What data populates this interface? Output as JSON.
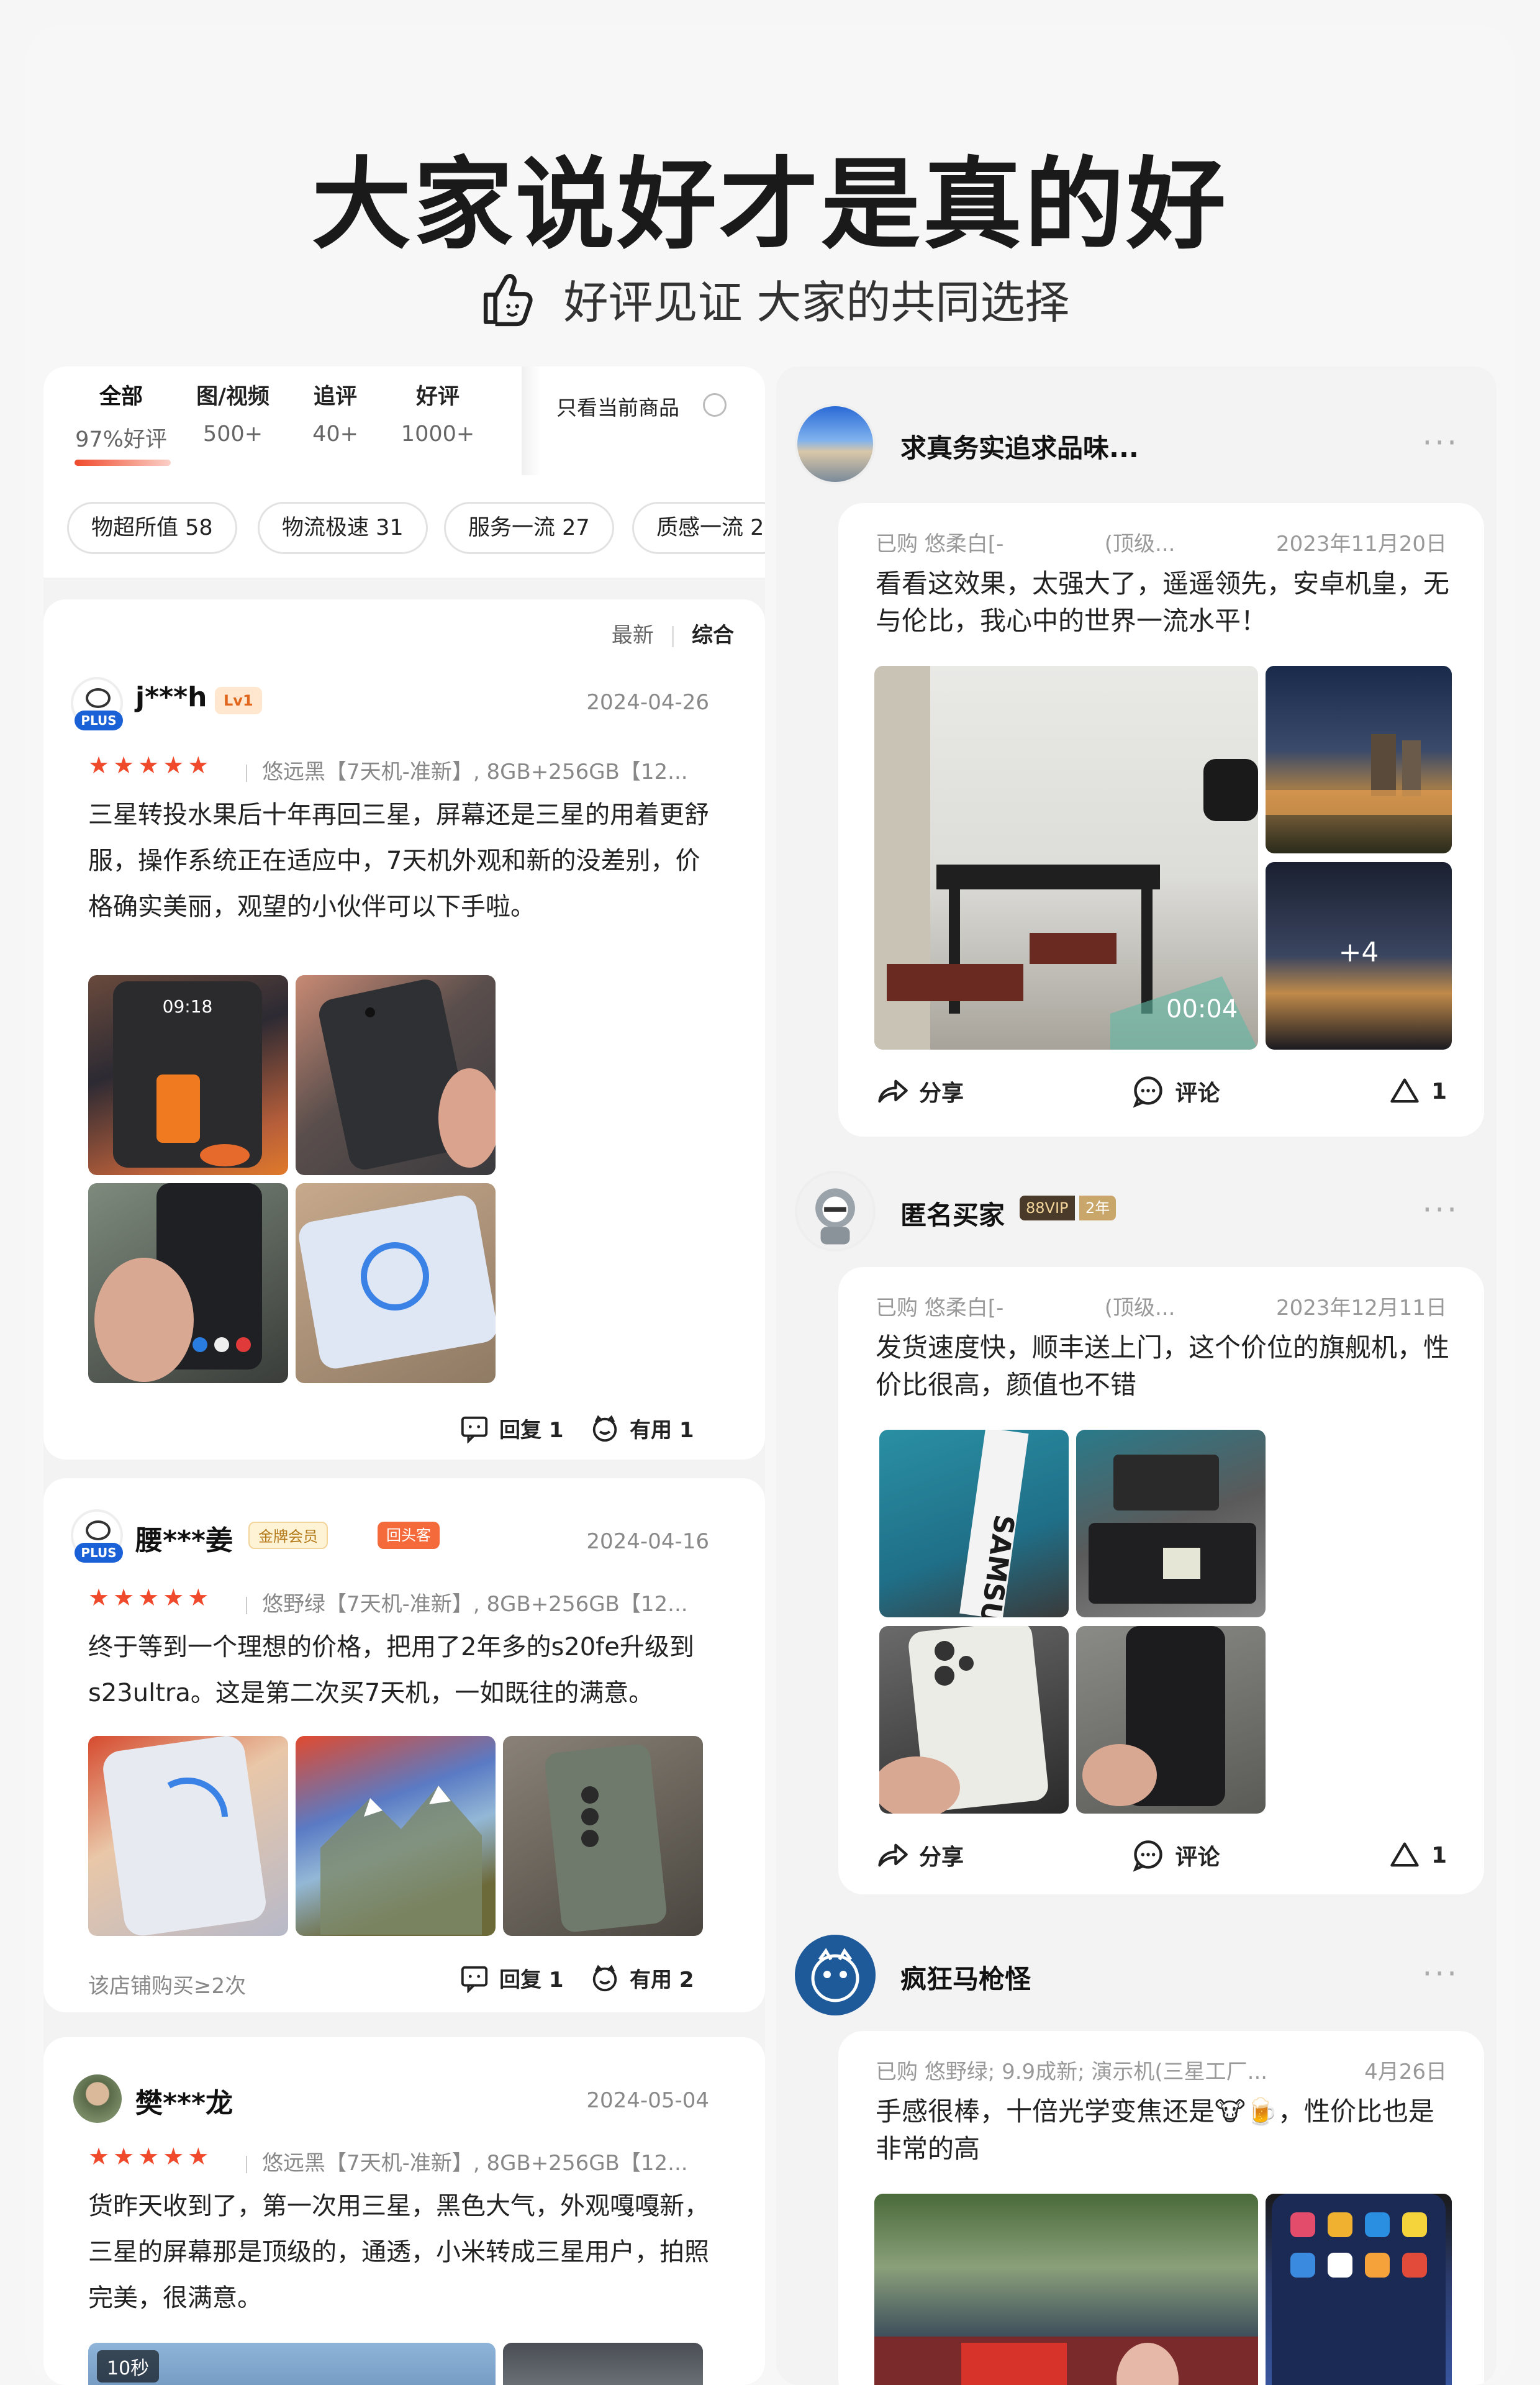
{
  "header": {
    "title": "大家说好才是真的好",
    "subtitle": "好评见证 大家的共同选择"
  },
  "left": {
    "tabs": [
      {
        "label": "全部",
        "count": "97%好评"
      },
      {
        "label": "图/视频",
        "count": "500+"
      },
      {
        "label": "追评",
        "count": "40+"
      },
      {
        "label": "好评",
        "count": "1000+"
      }
    ],
    "only_current": "只看当前商品",
    "chips": [
      "物超所值 58",
      "物流极速 31",
      "服务一流 27",
      "质感一流 2"
    ],
    "sort": {
      "latest": "最新",
      "overall": "综合"
    },
    "reviews": [
      {
        "user": "j***h",
        "badge": "Lv1",
        "plus": "PLUS",
        "date": "2024-04-26",
        "stars": "★★★★★",
        "spec": "悠远黑【7天机-准新】, 8GB+256GB【12...",
        "text": "三星转投水果后十年再回三星，屏幕还是三星的用着更舒服，操作系统正在适应中，7天机外观和新的没差别，价格确实美丽，观望的小伙伴可以下手啦。",
        "reply": "回复 1",
        "useful": "有用 1",
        "lock_time": "09:18"
      },
      {
        "user": "腰***姜",
        "plus": "PLUS",
        "gold": "金牌会员",
        "repeat": "回头客",
        "date": "2024-04-16",
        "stars": "★★★★★",
        "spec": "悠野绿【7天机-准新】, 8GB+256GB【12...",
        "text": "终于等到一个理想的价格，把用了2年多的s20fe升级到s23ultra。这是第二次买7天机，一如既往的满意。",
        "store": "该店铺购买≥2次",
        "reply": "回复 1",
        "useful": "有用 2"
      },
      {
        "user": "樊***龙",
        "date": "2024-05-04",
        "stars": "★★★★★",
        "spec": "悠远黑【7天机-准新】, 8GB+256GB【12...",
        "text": "货昨天收到了，第一次用三星，黑色大气，外观嘎嘎新，三星的屏幕那是顶级的，通透，小米转成三星用户，拍照完美，很满意。",
        "video_len": "10秒"
      }
    ]
  },
  "right": {
    "posts": [
      {
        "user": "求真务实追求品味...",
        "meta_left": "已购 悠柔白[-",
        "meta_mid": "(顶级...",
        "date": "2023年11月20日",
        "text": "看看这效果，太强大了，遥遥领先，安卓机皇，无与伦比，我心中的世界一流水平！",
        "video_time": "00:04",
        "more": "+4",
        "share": "分享",
        "comment": "评论",
        "likes": "1"
      },
      {
        "user": "匿名买家",
        "vip": "88VIP",
        "years": "2年",
        "meta_left": "已购 悠柔白[-",
        "meta_mid": "(顶级...",
        "date": "2023年12月11日",
        "text": "发货速度快，顺丰送上门，这个价位的旗舰机，性价比很高，颜值也不错",
        "box_text": "SAMSUNG",
        "share": "分享",
        "comment": "评论",
        "likes": "1"
      },
      {
        "user": "疯狂马枪怪",
        "meta_left": "已购 悠野绿; 9.9成新; 演示机(三星工厂...",
        "date": "4月26日",
        "text": "手感很棒，十倍光学变焦还是🐮🍺，性价比也是非常的高"
      }
    ]
  },
  "colors": {
    "accent": "#f04a2c",
    "star": "#f04a2c",
    "plus_blue": "#1a60d6"
  }
}
